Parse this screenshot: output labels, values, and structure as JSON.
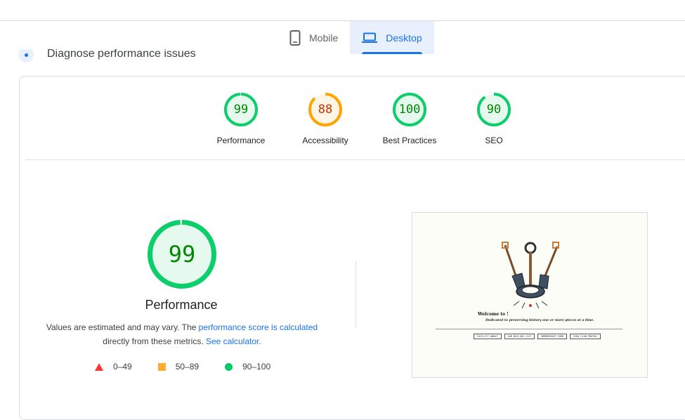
{
  "tabs": [
    {
      "label": "Mobile",
      "icon": "smartphone-icon",
      "active": false
    },
    {
      "label": "Desktop",
      "icon": "laptop-icon",
      "active": true
    }
  ],
  "diagnose": {
    "text": "Diagnose performance issues"
  },
  "categories": [
    {
      "label": "Performance",
      "score": "99",
      "fraction": 0.99,
      "color": "#0cce6b",
      "text_color": "#008800",
      "fill": "#e6f9ee"
    },
    {
      "label": "Accessibility",
      "score": "88",
      "fraction": 0.88,
      "color": "#ffa400",
      "text_color": "#c33300",
      "fill": "#fff5e6"
    },
    {
      "label": "Best Practices",
      "score": "100",
      "fraction": 1.0,
      "color": "#0cce6b",
      "text_color": "#008800",
      "fill": "#e6f9ee"
    },
    {
      "label": "SEO",
      "score": "90",
      "fraction": 0.9,
      "color": "#0cce6b",
      "text_color": "#008800",
      "fill": "#e6f9ee"
    }
  ],
  "main": {
    "score": "99",
    "fraction": 0.99,
    "title": "Performance",
    "desc_prefix": "Values are estimated and may vary. The ",
    "desc_link1": "performance score is calculated",
    "desc_middle": " directly from these metrics. ",
    "desc_link2": "See calculator",
    "desc_suffix": "."
  },
  "legend": [
    {
      "range": "0–49",
      "shape": "triangle",
      "color": "#ff3333"
    },
    {
      "range": "50–89",
      "shape": "square",
      "color": "#ffaa33"
    },
    {
      "range": "90–100",
      "shape": "circle",
      "color": "#00cc66"
    }
  ],
  "screenshot": {
    "welcome": "Welcome to !",
    "tagline": "Dedicated to preserving history one or more pieces at a time.",
    "buttons": [
      "FACILITY ABOUT",
      "OUR MAILING LIST",
      "MEMBERSHIP FORM",
      "VIEW CLUB PHOTOS"
    ]
  },
  "colors": {
    "accent": "#1a73e8",
    "pass": "#0cce6b",
    "average": "#ffa400",
    "fail": "#ff3333"
  }
}
